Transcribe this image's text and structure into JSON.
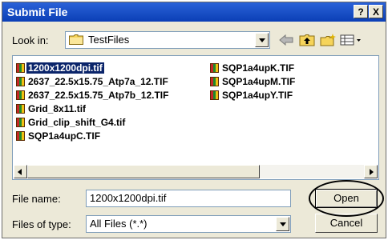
{
  "window": {
    "title": "Submit File",
    "help_label": "?",
    "close_label": "X"
  },
  "lookin": {
    "label": "Look in:",
    "folder": "TestFiles",
    "icons": [
      "back-arrow-icon",
      "up-folder-icon",
      "new-folder-icon",
      "view-menu-icon"
    ]
  },
  "files": {
    "left": [
      {
        "name": "1200x1200dpi.tif",
        "selected": true
      },
      {
        "name": "2637_22.5x15.75_Atp7a_12.TIF"
      },
      {
        "name": "2637_22.5x15.75_Atp7b_12.TIF"
      },
      {
        "name": "Grid_8x11.tif"
      },
      {
        "name": "Grid_clip_shift_G4.tif"
      },
      {
        "name": "SQP1a4upC.TIF"
      }
    ],
    "right": [
      {
        "name": "SQP1a4upK.TIF"
      },
      {
        "name": "SQP1a4upM.TIF"
      },
      {
        "name": "SQP1a4upY.TIF"
      }
    ],
    "icon_text": "TIFF"
  },
  "filename": {
    "label": "File name:",
    "value": "1200x1200dpi.tif"
  },
  "filetype": {
    "label": "Files of type:",
    "value": "All Files (*.*)"
  },
  "buttons": {
    "open": "Open",
    "cancel": "Cancel"
  },
  "colors": {
    "title_bar": "#0b3fb6",
    "selection": "#0a246a",
    "dialog_bg": "#ece9d8"
  }
}
